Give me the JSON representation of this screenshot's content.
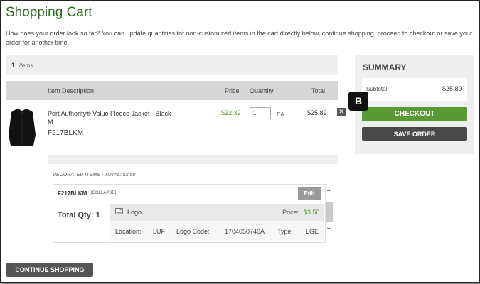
{
  "page": {
    "title": "Shopping Cart",
    "intro": "How does your order look so far? You can update quantities for non-customized items in the cart directly below, continue shopping, proceed to checkout or save your order for another time."
  },
  "cart": {
    "item_count": "1",
    "item_count_label": "items",
    "columns": [
      "Item Description",
      "Price",
      "Quantity",
      "Total"
    ],
    "item": {
      "name": "Port Authority® Value Fleece Jacket - Black - M",
      "sku": "F217BLKM",
      "price": "$22.39",
      "quantity": "1",
      "unit": "EA",
      "total": "$25.89",
      "remove_icon": "close-icon"
    },
    "decorated": {
      "label": "DECORATED ITEMS - TOTAL: $3.50",
      "sku": "F217BLKM",
      "collapse_label": "[COLLAPSE]",
      "edit_label": "Edit",
      "total_qty": "Total Qty: 1",
      "logo": {
        "title": "Logo",
        "price_label": "Price:",
        "price": "$3.50",
        "location_label": "Location:",
        "location": "LUF",
        "logo_code_label": "Logo Code:",
        "logo_code": "1704050740A",
        "type_label": "Type:",
        "type": "LGE"
      }
    }
  },
  "summary": {
    "title": "SUMMARY",
    "subtotal_label": "Subtotal",
    "subtotal": "$25.89",
    "checkout_label": "CHECKOUT",
    "save_label": "SAVE ORDER"
  },
  "actions": {
    "continue_label": "CONTINUE SHOPPING"
  },
  "annotation": {
    "marker": "B"
  },
  "colors": {
    "title_green": "#2d6b1f",
    "price_green": "#4a9a2a",
    "checkout_green": "#5a9a35",
    "dark_button": "#4a4a4a"
  }
}
